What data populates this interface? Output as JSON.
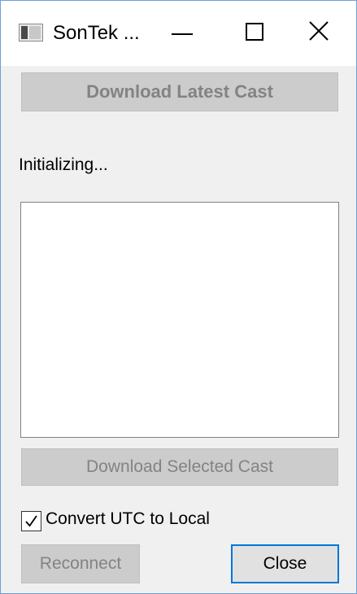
{
  "window": {
    "title": "SonTek ...",
    "border_color": "#6f9fd8"
  },
  "buttons": {
    "download_latest": "Download Latest Cast",
    "download_selected": "Download Selected Cast",
    "reconnect": "Reconnect",
    "close": "Close"
  },
  "status": "Initializing...",
  "cast_list": {
    "items": []
  },
  "options": {
    "convert_utc_label": "Convert UTC to Local",
    "convert_utc_checked": true
  },
  "colors": {
    "disabled_button_bg": "#cccccc",
    "disabled_text": "#838383",
    "focus_border": "#0078d7"
  },
  "icons": {
    "app": "app-window-icon",
    "minimize": "minimize-icon",
    "maximize": "maximize-icon",
    "close": "close-icon",
    "checkmark": "checkmark-icon"
  }
}
